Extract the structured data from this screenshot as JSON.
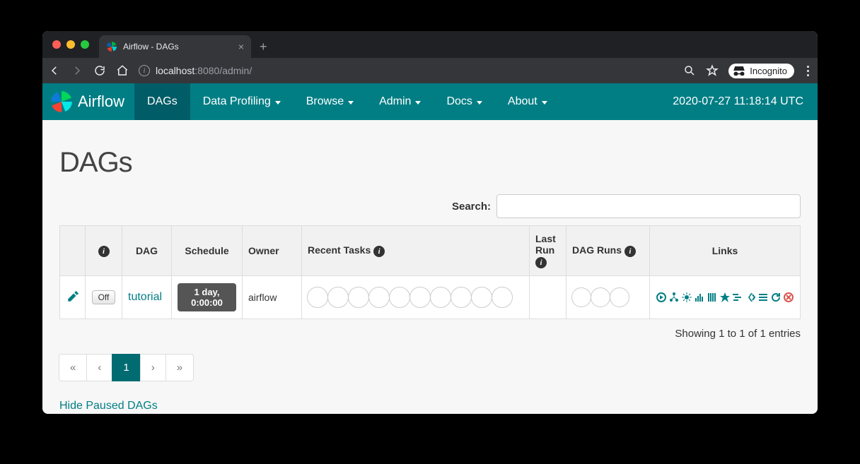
{
  "browser": {
    "tab_title": "Airflow - DAGs",
    "url_host": "localhost",
    "url_port": ":8080",
    "url_path": "/admin/",
    "incognito_label": "Incognito"
  },
  "navbar": {
    "brand": "Airflow",
    "items": [
      {
        "label": "DAGs",
        "active": true,
        "caret": false
      },
      {
        "label": "Data Profiling",
        "active": false,
        "caret": true
      },
      {
        "label": "Browse",
        "active": false,
        "caret": true
      },
      {
        "label": "Admin",
        "active": false,
        "caret": true
      },
      {
        "label": "Docs",
        "active": false,
        "caret": true
      },
      {
        "label": "About",
        "active": false,
        "caret": true
      }
    ],
    "clock": "2020-07-27 11:18:14 UTC"
  },
  "page": {
    "title": "DAGs",
    "search_label": "Search:",
    "search_value": "",
    "columns": {
      "dag": "DAG",
      "schedule": "Schedule",
      "owner": "Owner",
      "recent_tasks": "Recent Tasks",
      "last_run": "Last Run",
      "dag_runs": "DAG Runs",
      "links": "Links"
    },
    "rows": [
      {
        "toggle_state": "Off",
        "dag": "tutorial",
        "schedule": "1 day, 0:00:00",
        "owner": "airflow"
      }
    ],
    "entries_info": "Showing 1 to 1 of 1 entries",
    "pagination": [
      "«",
      "‹",
      "1",
      "›",
      "»"
    ],
    "pagination_active_index": 2,
    "hide_paused": "Hide Paused DAGs"
  },
  "link_icons": [
    "trigger-dag-icon",
    "tree-view-icon",
    "graph-view-icon",
    "task-duration-icon",
    "task-tries-icon",
    "landing-times-icon",
    "gantt-icon",
    "code-icon",
    "logs-icon",
    "refresh-icon",
    "delete-icon"
  ]
}
